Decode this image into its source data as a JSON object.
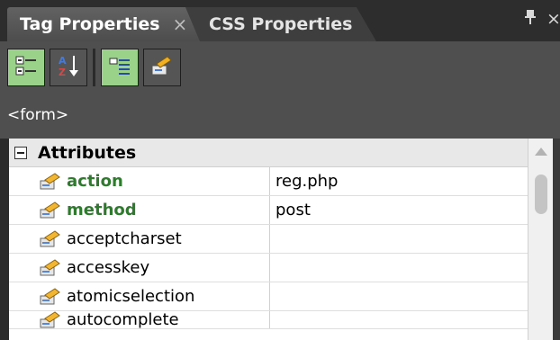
{
  "tabs": [
    {
      "label": "Tag Properties",
      "close_glyph": "×",
      "active": true
    },
    {
      "label": "CSS Properties",
      "active": false
    }
  ],
  "window_controls": {
    "pin_glyph": "📌",
    "close_glyph": "×"
  },
  "toolbar": {
    "buttons": [
      {
        "name": "category-view",
        "icon": "category-view-icon",
        "active": true
      },
      {
        "name": "sort-az",
        "icon": "sort-az-icon",
        "active": false
      },
      {
        "name": "set-properties-view",
        "icon": "list-set-properties-icon",
        "active": true
      },
      {
        "name": "tag-settings",
        "icon": "tag-settings-icon",
        "active": false
      }
    ]
  },
  "current_tag": "<form>",
  "category": {
    "title": "Attributes",
    "expanded": true
  },
  "properties": [
    {
      "name": "action",
      "value": "reg.php",
      "set": true
    },
    {
      "name": "method",
      "value": "post",
      "set": true
    },
    {
      "name": "acceptcharset",
      "value": "",
      "set": false
    },
    {
      "name": "accesskey",
      "value": "",
      "set": false
    },
    {
      "name": "atomicselection",
      "value": "",
      "set": false
    },
    {
      "name": "autocomplete",
      "value": "",
      "set": false
    }
  ],
  "colors": {
    "set_property": "#2f7a2f",
    "toggle_on": "#9bd28a",
    "panel_bg": "#4f4f4f"
  }
}
